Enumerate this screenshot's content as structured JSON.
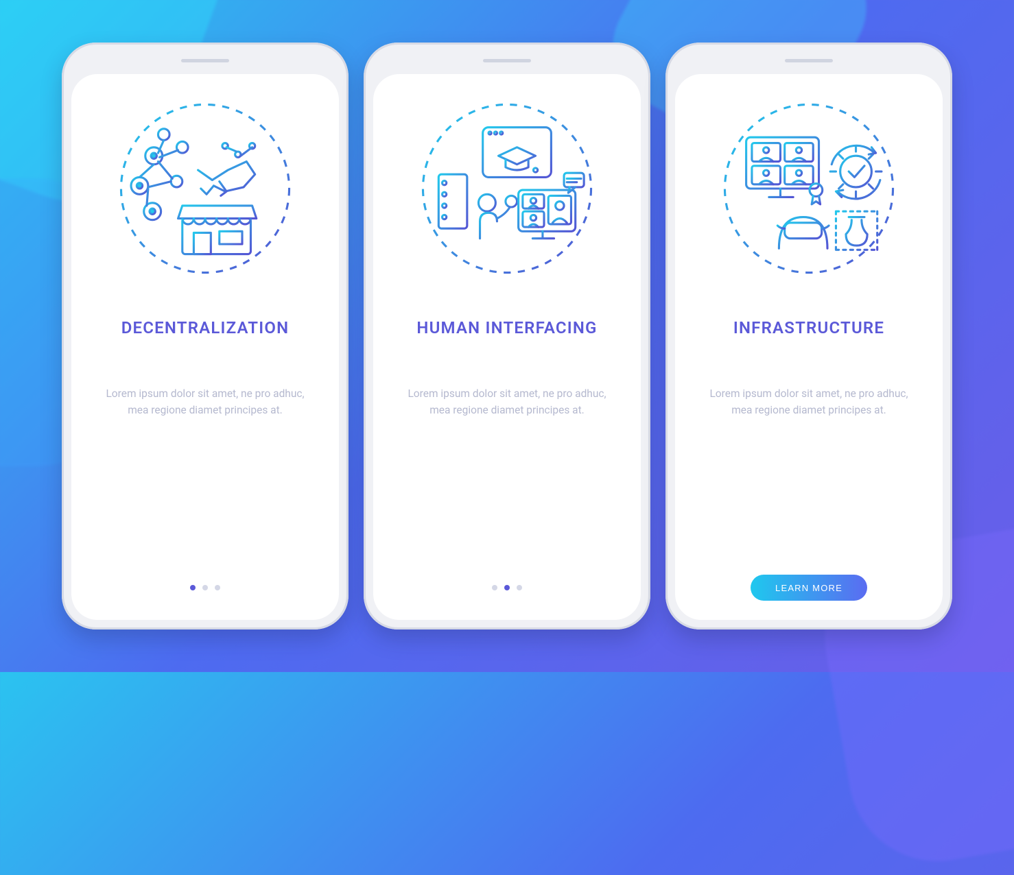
{
  "colors": {
    "title": "#5B59D8",
    "desc": "#B5B9CF",
    "dot_active": "#5B59D8",
    "dot": "#D4D7E6",
    "cta_gradient_from": "#1FC8EE",
    "cta_gradient_to": "#5A6CF1"
  },
  "cards": [
    {
      "title": "DECENTRALIZATION",
      "description": "Lorem ipsum dolor sit amet, ne pro adhuc, mea regione diamet principes at.",
      "icon": "decentralization-icon",
      "pager": {
        "total": 3,
        "active_index": 0
      },
      "cta": null
    },
    {
      "title": "HUMAN INTERFACING",
      "description": "Lorem ipsum dolor sit amet, ne pro adhuc, mea regione diamet principes at.",
      "icon": "human-interfacing-icon",
      "pager": {
        "total": 3,
        "active_index": 1
      },
      "cta": null
    },
    {
      "title": "INFRASTRUCTURE",
      "description": "Lorem ipsum dolor sit amet, ne pro adhuc, mea regione diamet principes at.",
      "icon": "infrastructure-icon",
      "pager": null,
      "cta": {
        "label": "LEARN MORE"
      }
    }
  ]
}
